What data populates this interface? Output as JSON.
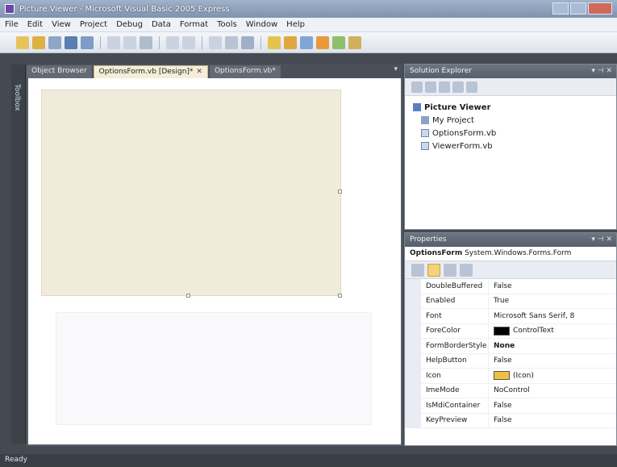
{
  "window": {
    "title": "Picture Viewer - Microsoft Visual Basic 2005 Express"
  },
  "menu": [
    "File",
    "Edit",
    "View",
    "Project",
    "Debug",
    "Data",
    "Format",
    "Tools",
    "Window",
    "Help"
  ],
  "side_tab": {
    "label": "Toolbox"
  },
  "tabs": [
    {
      "label": "Object Browser",
      "active": false
    },
    {
      "label": "OptionsForm.vb [Design]*",
      "active": true
    },
    {
      "label": "OptionsForm.vb*",
      "active": false
    }
  ],
  "solution_explorer": {
    "title": "Solution Explorer",
    "root": "Picture Viewer",
    "items": [
      "My Project",
      "OptionsForm.vb",
      "ViewerForm.vb"
    ]
  },
  "properties": {
    "title": "Properties",
    "object_name": "OptionsForm",
    "object_type": "System.Windows.Forms.Form",
    "rows": [
      {
        "name": "DoubleBuffered",
        "value": "False"
      },
      {
        "name": "Enabled",
        "value": "True"
      },
      {
        "name": "Font",
        "value": "Microsoft Sans Serif, 8"
      },
      {
        "name": "ForeColor",
        "value": "ControlText",
        "swatch": "#000000"
      },
      {
        "name": "FormBorderStyle",
        "value": "None",
        "bold": true
      },
      {
        "name": "HelpButton",
        "value": "False"
      },
      {
        "name": "Icon",
        "value": "(Icon)",
        "swatch": "#f0c040"
      },
      {
        "name": "ImeMode",
        "value": "NoControl"
      },
      {
        "name": "IsMdiContainer",
        "value": "False"
      },
      {
        "name": "KeyPreview",
        "value": "False"
      }
    ]
  },
  "status": {
    "text": "Ready"
  }
}
